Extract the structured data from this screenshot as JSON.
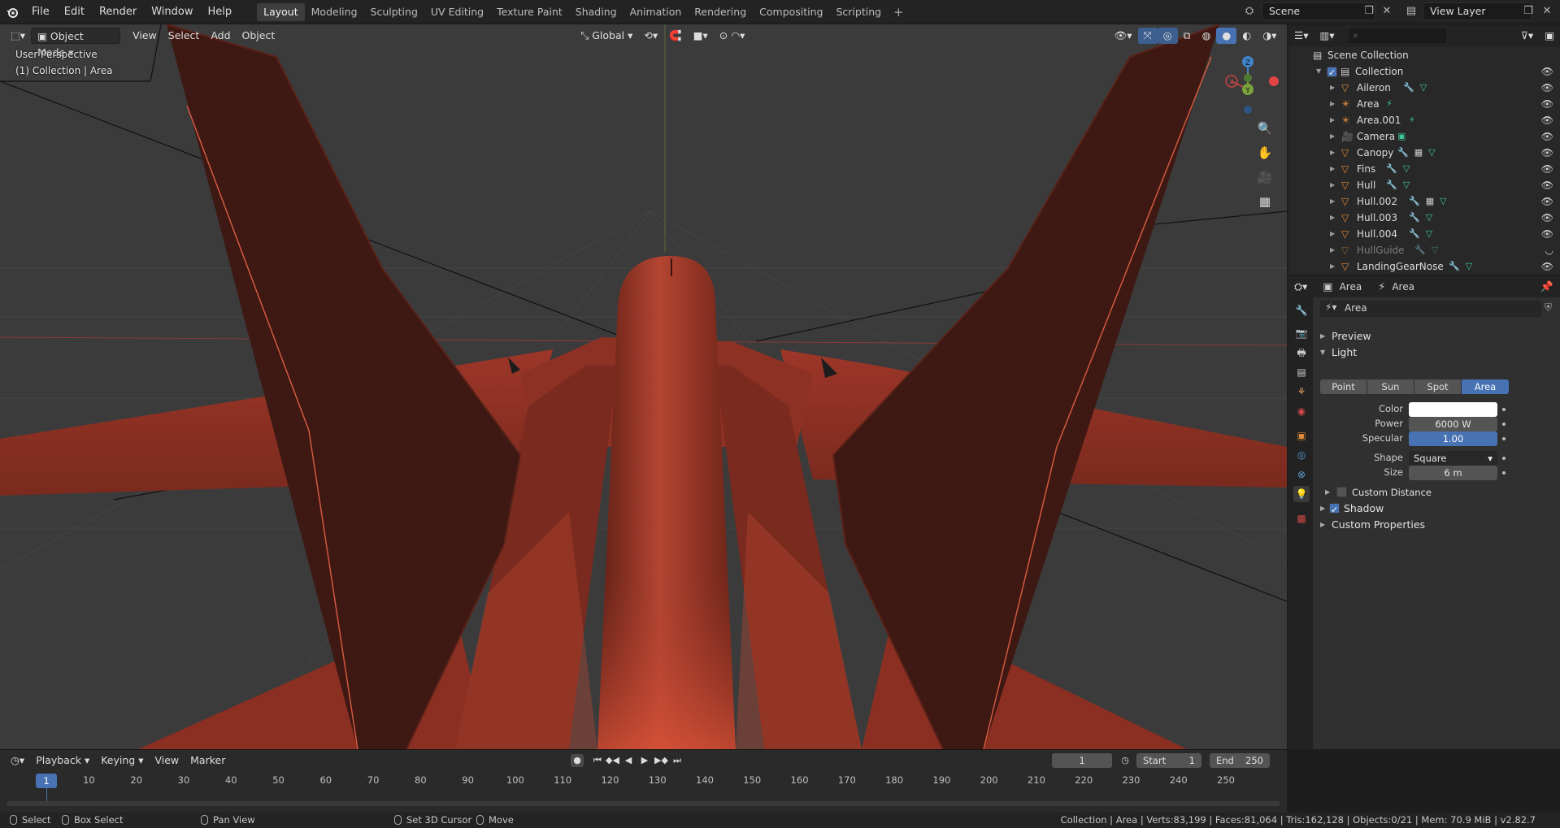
{
  "topbar": {
    "menus": [
      "File",
      "Edit",
      "Render",
      "Window",
      "Help"
    ],
    "workspaces": [
      "Layout",
      "Modeling",
      "Sculpting",
      "UV Editing",
      "Texture Paint",
      "Shading",
      "Animation",
      "Rendering",
      "Compositing",
      "Scripting"
    ],
    "active_workspace": "Layout",
    "add_icon": "+",
    "scene": "Scene",
    "view_layer": "View Layer"
  },
  "viewport": {
    "mode": "Object Mode",
    "menus": [
      "View",
      "Select",
      "Add",
      "Object"
    ],
    "orientation": "Global",
    "perspective_label": "User Perspective",
    "collection_label": "(1) Collection | Area",
    "gizmo": {
      "z": "Z",
      "y": "Y",
      "x": "X"
    }
  },
  "outliner": {
    "root": "Scene Collection",
    "collection": "Collection",
    "items": [
      {
        "name": "Aileron",
        "icon": "mesh-icon",
        "mods": "modifier+mesh"
      },
      {
        "name": "Area",
        "icon": "light-icon",
        "mods": "light-data"
      },
      {
        "name": "Area.001",
        "icon": "light-icon",
        "mods": "light-data"
      },
      {
        "name": "Camera",
        "icon": "camera-icon",
        "mods": "camera-data"
      },
      {
        "name": "Canopy",
        "icon": "mesh-icon",
        "mods": "modifier+material+mesh"
      },
      {
        "name": "Fins",
        "icon": "mesh-icon",
        "mods": "modifier+mesh"
      },
      {
        "name": "Hull",
        "icon": "mesh-icon",
        "mods": "modifier+mesh"
      },
      {
        "name": "Hull.002",
        "icon": "mesh-icon",
        "mods": "modifier+material+mesh"
      },
      {
        "name": "Hull.003",
        "icon": "mesh-icon",
        "mods": "modifier+mesh"
      },
      {
        "name": "Hull.004",
        "icon": "mesh-icon",
        "mods": "modifier+mesh"
      },
      {
        "name": "HullGuide",
        "icon": "mesh-icon",
        "mods": "modifier+mesh",
        "hidden": true
      },
      {
        "name": "LandingGearNose",
        "icon": "mesh-icon",
        "mods": "modifier+mesh"
      }
    ]
  },
  "properties": {
    "breadcrumb_object": "Area",
    "breadcrumb_data": "Area",
    "datablock_name": "Area",
    "panels": {
      "preview": "Preview",
      "light": "Light",
      "custom_distance": "Custom Distance",
      "shadow": "Shadow",
      "custom_properties": "Custom Properties"
    },
    "light_types": [
      "Point",
      "Sun",
      "Spot",
      "Area"
    ],
    "active_light_type": "Area",
    "color_label": "Color",
    "color_value": "#ffffff",
    "power_label": "Power",
    "power_value": "6000 W",
    "specular_label": "Specular",
    "specular_value": "1.00",
    "shape_label": "Shape",
    "shape_value": "Square",
    "size_label": "Size",
    "size_value": "6 m",
    "custom_distance_checked": false,
    "shadow_checked": true
  },
  "timeline": {
    "menus": [
      "Playback",
      "Keying",
      "View",
      "Marker"
    ],
    "current_frame": "1",
    "start_label": "Start",
    "start_value": "1",
    "end_label": "End",
    "end_value": "250",
    "ticks": [
      "10",
      "20",
      "30",
      "40",
      "50",
      "60",
      "70",
      "80",
      "90",
      "100",
      "110",
      "120",
      "130",
      "140",
      "150",
      "160",
      "170",
      "180",
      "190",
      "200",
      "210",
      "220",
      "230",
      "240",
      "250"
    ],
    "ruler_current": "1"
  },
  "statusbar": {
    "select": "Select",
    "box_select": "Box Select",
    "pan_view": "Pan View",
    "set_cursor": "Set 3D Cursor",
    "move": "Move",
    "stats": "Collection | Area | Verts:83,199 | Faces:81,064 | Tris:162,128 | Objects:0/21 | Mem: 70.9 MiB | v2.82.7"
  },
  "colors": {
    "accent": "#4772b3",
    "model_red": "#a83a2a",
    "viewport_bg": "#3b3b3b"
  }
}
